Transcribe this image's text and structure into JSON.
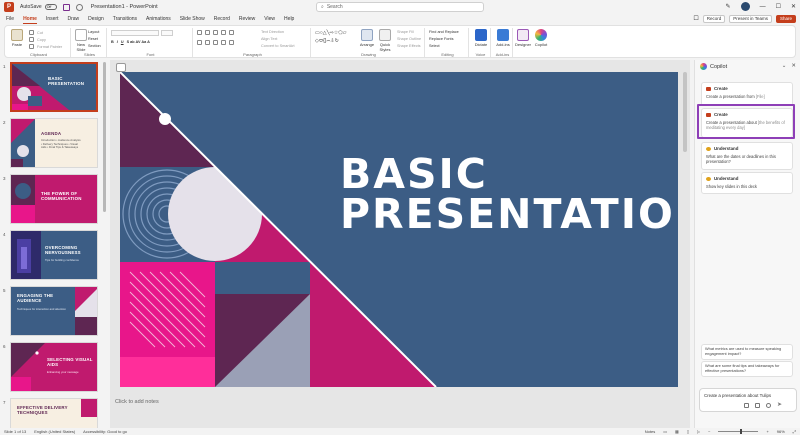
{
  "titlebar": {
    "autosave_label": "AutoSave",
    "autosave_state": "Off",
    "doc_title": "Presentation1 - PowerPoint",
    "search_placeholder": "Search",
    "record_label": "Record",
    "present_label": "Present in Teams",
    "share_label": "Share"
  },
  "menu": {
    "tabs": [
      "File",
      "Home",
      "Insert",
      "Draw",
      "Design",
      "Transitions",
      "Animations",
      "Slide Show",
      "Record",
      "Review",
      "View",
      "Help"
    ],
    "active": "Home"
  },
  "ribbon": {
    "clipboard": {
      "label": "Clipboard",
      "paste": "Paste",
      "cut": "Cut",
      "copy": "Copy",
      "format_painter": "Format Painter"
    },
    "slides": {
      "label": "Slides",
      "new_slide": "New Slide",
      "layout": "Layout",
      "reset": "Reset",
      "section": "Section"
    },
    "font": {
      "label": "Font"
    },
    "paragraph": {
      "label": "Paragraph",
      "text_direction": "Text Direction",
      "align_text": "Align Text",
      "smartart": "Convert to SmartArt"
    },
    "drawing": {
      "label": "Drawing",
      "arrange": "Arrange",
      "quick_styles": "Quick Styles",
      "shape_fill": "Shape Fill",
      "shape_outline": "Shape Outline",
      "shape_effects": "Shape Effects"
    },
    "editing": {
      "label": "Editing",
      "find_replace": "Find and Replace",
      "replace_fonts": "Replace Fonts",
      "select": "Select"
    },
    "voice": {
      "label": "Voice",
      "dictate": "Dictate"
    },
    "addins": {
      "label": "Add-ins",
      "addins": "Add-ins"
    },
    "designer": "Designer",
    "copilot": "Copilot"
  },
  "thumbnails": [
    {
      "num": "1",
      "title": "BASIC PRESENTATION",
      "sub": ""
    },
    {
      "num": "2",
      "title": "AGENDA",
      "sub": "Introduction • Audience Analysis • Delivery Techniques • Visual Aids • Final Tips & Takeaways"
    },
    {
      "num": "3",
      "title": "THE POWER OF COMMUNICATION",
      "sub": ""
    },
    {
      "num": "4",
      "title": "OVERCOMING NERVOUSNESS",
      "sub": "Tips for building confidence"
    },
    {
      "num": "5",
      "title": "ENGAGING THE AUDIENCE",
      "sub": "Techniques for interaction and attention"
    },
    {
      "num": "6",
      "title": "SELECTING VISUAL AIDS",
      "sub": "Enhancing your message"
    },
    {
      "num": "7",
      "title": "EFFECTIVE DELIVERY TECHNIQUES",
      "sub": ""
    }
  ],
  "slide": {
    "title_line1": "BASIC",
    "title_line2": "PRESENTATION",
    "notes_placeholder": "Click to add notes",
    "colors": {
      "navy": "#3c5d85",
      "magenta": "#c01a6e",
      "purple": "#5e2652",
      "light": "#e5e1ea",
      "pink": "#e8168a"
    }
  },
  "copilot": {
    "title": "Copilot",
    "cards": [
      {
        "head": "Create",
        "text": "Create a presentation from",
        "hint": "[File]"
      },
      {
        "head": "Create",
        "text": "Create a presentation about",
        "hint": "[the benefits of meditating every day]"
      },
      {
        "head": "Understand",
        "text": "What are the dates or deadlines in this presentation?",
        "hint": ""
      },
      {
        "head": "Understand",
        "text": "Show key slides in this deck",
        "hint": ""
      }
    ],
    "suggestions": [
      "What metrics are used to measure speaking engagement impact?",
      "What are some final tips and takeaways for effective presentations?"
    ],
    "input_text": "Create a presentation about Tulips"
  },
  "status": {
    "slide_info": "Slide 1 of 13",
    "language": "English (United States)",
    "accessibility": "Accessibility: Good to go",
    "notes": "Notes",
    "zoom": "96%"
  }
}
